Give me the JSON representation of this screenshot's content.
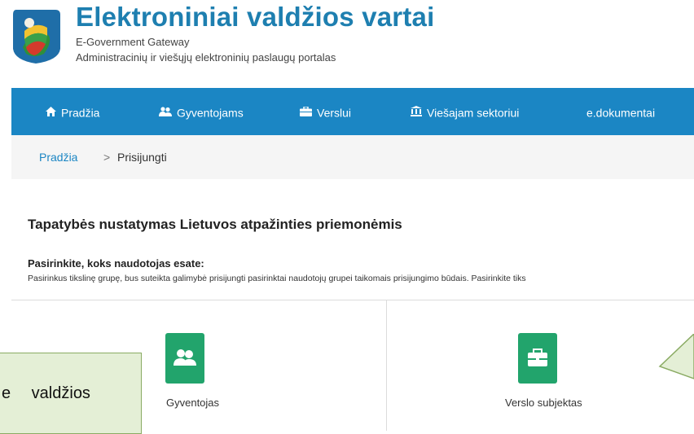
{
  "header": {
    "title": "Elektroniniai valdžios vartai",
    "subtitle_en": "E-Government Gateway",
    "subtitle_lt": "Administracinių ir viešųjų elektroninių paslaugų portalas",
    "logo_icon": "lithuania-coat-of-arms-logo"
  },
  "nav": {
    "items": [
      {
        "label": "Pradžia",
        "icon": "home-icon"
      },
      {
        "label": "Gyventojams",
        "icon": "people-icon"
      },
      {
        "label": "Verslui",
        "icon": "briefcase-icon"
      },
      {
        "label": "Viešajam sektoriui",
        "icon": "institution-icon"
      },
      {
        "label": "e.dokumentai",
        "icon": ""
      }
    ],
    "color": "#1b86c4"
  },
  "breadcrumb": {
    "home": "Pradžia",
    "separator": ">",
    "current": "Prisijungti"
  },
  "main": {
    "heading": "Tapatybės nustatymas Lietuvos atpažinties priemonėmis",
    "question": "Pasirinkite, koks naudotojas esate:",
    "description": "Pasirinkus tikslinę grupę, bus suteikta galimybė prisijungti pasirinktai naudotojų grupei taikomais prisijungimo būdais. Pasirinkite tiks",
    "cards": [
      {
        "label": "Gyventojas",
        "icon": "people-icon"
      },
      {
        "label": "Verslo subjektas",
        "icon": "briefcase-icon"
      }
    ],
    "card_icon_color": "#22a46c"
  },
  "overlay": {
    "box_text": "e valdžios",
    "box_color": "#e4efd6"
  }
}
